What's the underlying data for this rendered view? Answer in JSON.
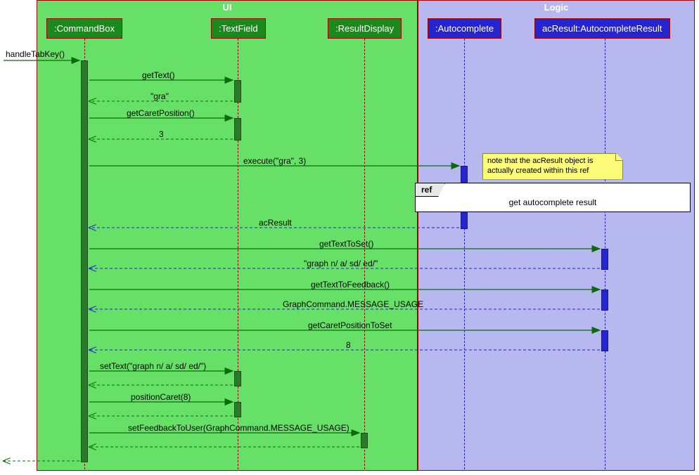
{
  "groups": {
    "ui": {
      "title": "UI"
    },
    "logic": {
      "title": "Logic"
    }
  },
  "participants": {
    "commandBox": {
      "label": ":CommandBox"
    },
    "textField": {
      "label": ":TextField"
    },
    "resultDisplay": {
      "label": ":ResultDisplay"
    },
    "autocomplete": {
      "label": ":Autocomplete"
    },
    "acResult": {
      "label": "acResult:AutocompleteResult"
    }
  },
  "messages": {
    "handleTabKey": "handleTabKey()",
    "getText": "getText()",
    "retGra": "\"gra\"",
    "getCaretPosition": "getCaretPosition()",
    "ret3": "3",
    "execute": "execute(\"gra\", 3)",
    "retAcResult": "acResult",
    "getTextToSet": "getTextToSet()",
    "retGraph": "\"graph n/ a/ sd/ ed/\"",
    "getTextToFeedback": "getTextToFeedback()",
    "retMsgUsage": "GraphCommand.MESSAGE_USAGE",
    "getCaretPositionToSet": "getCaretPositionToSet",
    "ret8": "8",
    "setText": "setText(\"graph n/ a/ sd/ ed/\")",
    "positionCaret": "positionCaret(8)",
    "setFeedbackToUser": "setFeedbackToUser(GraphCommand.MESSAGE_USAGE)"
  },
  "note": {
    "line1": "note that the acResult object is",
    "line2": "actually created within this ref"
  },
  "ref": {
    "tag": "ref",
    "text": "get autocomplete result"
  }
}
